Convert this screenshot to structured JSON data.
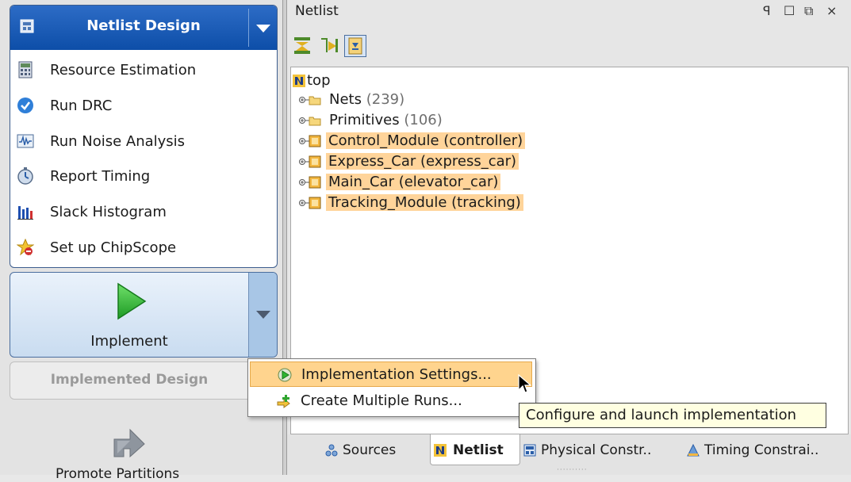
{
  "left_panel": {
    "netlist_design": {
      "title": "Netlist Design",
      "tasks": [
        {
          "label": "Resource Estimation",
          "icon": "calculator-icon"
        },
        {
          "label": "Run DRC",
          "icon": "check-circle-icon"
        },
        {
          "label": "Run Noise Analysis",
          "icon": "waveform-icon"
        },
        {
          "label": "Report Timing",
          "icon": "stopwatch-icon"
        },
        {
          "label": "Slack Histogram",
          "icon": "histogram-icon"
        },
        {
          "label": "Set up ChipScope",
          "icon": "chipscope-icon"
        }
      ]
    },
    "implement": {
      "label": "Implement"
    },
    "implemented_design": {
      "label": "Implemented Design"
    },
    "promote": {
      "label": "Promote Partitions"
    }
  },
  "netlist_panel": {
    "title": "Netlist",
    "window_buttons": {
      "pin": "ꟼ",
      "maximize": "☐",
      "restore": "⧉",
      "close": "×"
    },
    "tree": {
      "root": "top",
      "children": [
        {
          "label": "Nets",
          "count": "(239)",
          "type": "folder",
          "highlight": false
        },
        {
          "label": "Primitives",
          "count": "(106)",
          "type": "folder",
          "highlight": false
        },
        {
          "label": "Control_Module (controller)",
          "count": "",
          "type": "module",
          "highlight": true
        },
        {
          "label": "Express_Car (express_car)",
          "count": "",
          "type": "module",
          "highlight": true
        },
        {
          "label": "Main_Car (elevator_car)",
          "count": "",
          "type": "module",
          "highlight": true
        },
        {
          "label": "Tracking_Module (tracking)",
          "count": "",
          "type": "module",
          "highlight": true
        }
      ]
    },
    "tabs": [
      {
        "label": "Sources",
        "active": false
      },
      {
        "label": "Netlist",
        "active": true
      },
      {
        "label": "Physical Constr..",
        "active": false
      },
      {
        "label": "Timing Constrai..",
        "active": false
      }
    ]
  },
  "popup_menu": {
    "items": [
      {
        "label": "Implementation Settings...",
        "icon": "play-settings-icon",
        "hovered": true
      },
      {
        "label": "Create Multiple Runs...",
        "icon": "add-runs-icon",
        "hovered": false
      }
    ]
  },
  "tooltip": {
    "text": "Configure and launch implementation"
  },
  "colors": {
    "header_blue": "#0d4ea8",
    "highlight_orange": "#ffd49a",
    "play_green": "#2fb52f",
    "tooltip_bg": "#ffffe1"
  }
}
